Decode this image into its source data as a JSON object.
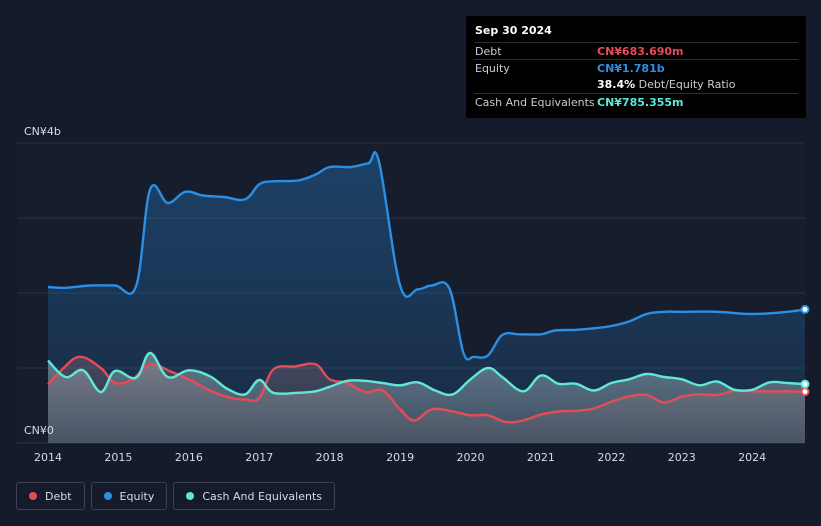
{
  "chart_data": {
    "type": "area",
    "ylabel_top": "CN¥4b",
    "ylabel_bottom": "CN¥0",
    "ylim": [
      0,
      4000
    ],
    "xlim": [
      2014.0,
      2024.75
    ],
    "x_ticks": [
      "2014",
      "2015",
      "2016",
      "2017",
      "2018",
      "2019",
      "2020",
      "2021",
      "2022",
      "2023",
      "2024"
    ],
    "grid": true,
    "legend_position": "bottom-left",
    "series": [
      {
        "name": "Equity",
        "color": "#2b8fe6",
        "x": [
          2014.0,
          2014.25,
          2014.6,
          2014.95,
          2015.25,
          2015.45,
          2015.7,
          2015.95,
          2016.2,
          2016.5,
          2016.8,
          2017.0,
          2017.2,
          2017.55,
          2017.8,
          2018.0,
          2018.3,
          2018.55,
          2018.7,
          2019.0,
          2019.25,
          2019.45,
          2019.7,
          2019.9,
          2020.05,
          2020.25,
          2020.45,
          2020.7,
          2021.0,
          2021.2,
          2021.5,
          2021.75,
          2022.0,
          2022.25,
          2022.5,
          2022.75,
          2023.0,
          2023.5,
          2024.0,
          2024.5,
          2024.75
        ],
        "values": [
          2080,
          2070,
          2100,
          2100,
          2090,
          3380,
          3200,
          3350,
          3300,
          3280,
          3250,
          3450,
          3490,
          3500,
          3580,
          3680,
          3680,
          3730,
          3750,
          2100,
          2050,
          2100,
          2060,
          1200,
          1150,
          1170,
          1440,
          1450,
          1450,
          1500,
          1510,
          1530,
          1560,
          1620,
          1720,
          1750,
          1750,
          1750,
          1720,
          1750,
          1781
        ]
      },
      {
        "name": "Debt",
        "color": "#e64c55",
        "x": [
          2014.0,
          2014.2,
          2014.45,
          2014.75,
          2014.95,
          2015.2,
          2015.45,
          2015.75,
          2016.0,
          2016.3,
          2016.6,
          2016.8,
          2017.0,
          2017.2,
          2017.5,
          2017.8,
          2018.0,
          2018.25,
          2018.5,
          2018.75,
          2019.0,
          2019.2,
          2019.45,
          2019.75,
          2020.0,
          2020.25,
          2020.5,
          2020.75,
          2021.0,
          2021.25,
          2021.5,
          2021.75,
          2022.0,
          2022.25,
          2022.5,
          2022.75,
          2023.0,
          2023.25,
          2023.5,
          2023.75,
          2024.0,
          2024.5,
          2024.75
        ],
        "values": [
          780,
          980,
          1150,
          1000,
          800,
          850,
          1050,
          950,
          850,
          700,
          600,
          580,
          600,
          980,
          1020,
          1050,
          850,
          800,
          680,
          700,
          450,
          300,
          450,
          420,
          370,
          370,
          280,
          300,
          380,
          420,
          430,
          460,
          550,
          620,
          640,
          540,
          620,
          650,
          640,
          700,
          690,
          690,
          684
        ]
      },
      {
        "name": "Cash And Equivalents",
        "color": "#5fe8d6",
        "x": [
          2014.0,
          2014.25,
          2014.5,
          2014.75,
          2014.95,
          2015.25,
          2015.45,
          2015.7,
          2016.0,
          2016.3,
          2016.55,
          2016.8,
          2017.0,
          2017.2,
          2017.55,
          2017.8,
          2018.0,
          2018.25,
          2018.5,
          2018.75,
          2019.0,
          2019.25,
          2019.5,
          2019.75,
          2020.0,
          2020.25,
          2020.45,
          2020.75,
          2021.0,
          2021.25,
          2021.5,
          2021.75,
          2022.0,
          2022.25,
          2022.5,
          2022.75,
          2023.0,
          2023.25,
          2023.5,
          2023.75,
          2024.0,
          2024.25,
          2024.5,
          2024.75
        ],
        "values": [
          1100,
          880,
          970,
          680,
          960,
          870,
          1200,
          880,
          970,
          890,
          720,
          650,
          840,
          670,
          670,
          690,
          750,
          830,
          830,
          800,
          770,
          810,
          700,
          650,
          850,
          1000,
          880,
          690,
          900,
          790,
          790,
          700,
          800,
          850,
          920,
          880,
          850,
          770,
          820,
          710,
          710,
          810,
          800,
          785
        ]
      }
    ],
    "tooltip": {
      "date": "Sep 30 2024",
      "rows": [
        {
          "label": "Debt",
          "value": "CN¥683.690m",
          "color": "#e64c55"
        },
        {
          "label": "Equity",
          "value": "CN¥1.781b",
          "color": "#2b8fe6"
        },
        {
          "label": "",
          "ratio_pct": "38.4%",
          "ratio_label": "Debt/Equity Ratio"
        },
        {
          "label": "Cash And Equivalents",
          "value": "CN¥785.355m",
          "color": "#5fe8d6"
        }
      ]
    },
    "legend": [
      {
        "label": "Debt",
        "color": "#e64c55"
      },
      {
        "label": "Equity",
        "color": "#2b8fe6"
      },
      {
        "label": "Cash And Equivalents",
        "color": "#5fe8d6"
      }
    ]
  }
}
